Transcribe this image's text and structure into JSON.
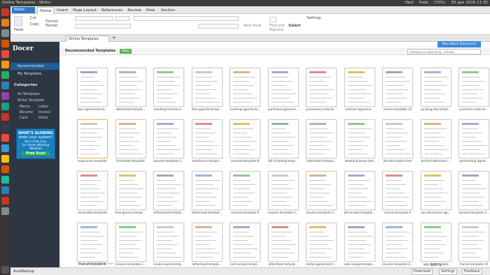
{
  "system_bar": {
    "title": "Online Templates - Writer",
    "tray": [
      "Hezi",
      "Fede",
      "(70%)",
      "30 дек 2016 11:35"
    ]
  },
  "menu": {
    "app_button": "Writer",
    "tabs": [
      "Home",
      "Insert",
      "Page Layout",
      "References",
      "Review",
      "View",
      "Section"
    ],
    "active_tab": "Home"
  },
  "ribbon": {
    "cut": "Cut",
    "copy": "Copy",
    "format_painter": "Format Painter",
    "paste": "Paste",
    "new_style": "New Style",
    "find_replace": "Find and Replace",
    "select": "Select",
    "settings": "Settings"
  },
  "tabs": {
    "doc_tab": "Online Templates"
  },
  "sidebar": {
    "logo": "Docer",
    "items": [
      {
        "label": "Recommended",
        "active": true
      },
      {
        "label": "My Templates",
        "active": false
      }
    ],
    "categories_title": "Categories",
    "all_templates": "All Templates",
    "writer_template": "Writer Template",
    "subcategories": [
      "Memo",
      "Letter",
      "Resume",
      "Invoice",
      "Card",
      "Other"
    ],
    "ad": {
      "line1": "WHAT'S SLOWING",
      "line2": "down your system?",
      "line3": "Run a free scan",
      "line4": "for issues affecting Windows",
      "button": "Free Scan"
    }
  },
  "main": {
    "section_title": "Recommended Templates",
    "badge": "New",
    "search_placeholder": "Everyone is searching : resume",
    "new_doc_button": "New Blank Document",
    "view_all": "View all templates >>",
    "templates": [
      "loan-agreement-te...",
      "letterhead-templa...",
      "meeting-minutes-t...",
      "free-agenda-templ...",
      "meeting-agenda-fo...",
      "purchase-agreeme...",
      "promissory-note-te...",
      "contract-agreeme...",
      "memo-template-14",
      "packing-slip-templ...",
      "purchase-order-te...",
      "supervisor-template",
      "timetable-template",
      "resume-template-1...",
      "remittance-templa...",
      "resume-template-8",
      "bill-of-lading-temp...",
      "letterhead templa...",
      "weekly-planner-tem",
      "job-description-tem",
      "perfect-attendanc...",
      "partnership-agree...",
      "receivable-template",
      "free-grocery-templ...",
      "letterhead-templat...",
      "letterhead-templat...",
      "resume-template-5",
      "resume-template-1...",
      "resume-template-1...",
      "bill-receipt-templat...",
      "memo-template-3",
      "non-disclosure-agr...",
      "resume-template-1...",
      "memo-template-8",
      "resume-template-1...",
      "invoice-word-temp...",
      "letterhead-templa...",
      "rent-receipt-templ...",
      "letterhead templa...",
      "rental-agreement-t...",
      "sale-receipt-templa...",
      "resume template 2...",
      "agenda-template",
      "memo-template-15"
    ]
  },
  "bottom": {
    "autobackup": "AutoBackup",
    "download": "Download",
    "settings": "Settings",
    "feedback": "Feedback",
    "zoom": "100 %"
  },
  "colors": {
    "sidebar_bg": "#2e3643",
    "accent": "#2f79c9",
    "launcher_bg": "#3a3438"
  }
}
